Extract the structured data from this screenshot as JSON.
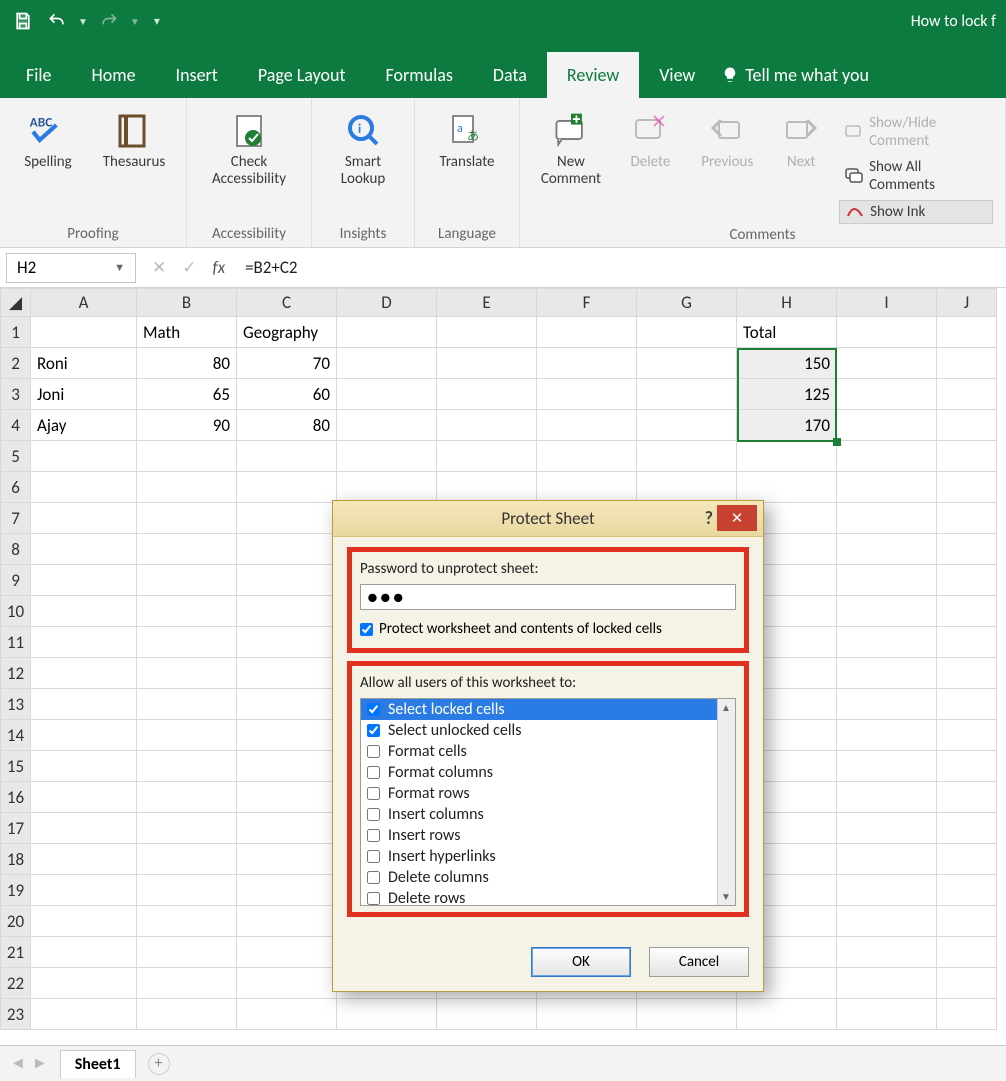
{
  "titlebar": {
    "doc_title": "How to lock f"
  },
  "tabs": {
    "file": "File",
    "home": "Home",
    "insert": "Insert",
    "pagelayout": "Page Layout",
    "formulas": "Formulas",
    "data": "Data",
    "review": "Review",
    "view": "View",
    "tellme": "Tell me what you"
  },
  "ribbon": {
    "proofing": {
      "label": "Proofing",
      "spelling": "Spelling",
      "thesaurus": "Thesaurus"
    },
    "accessibility": {
      "label": "Accessibility",
      "check": "Check\nAccessibility"
    },
    "insights": {
      "label": "Insights",
      "lookup": "Smart\nLookup"
    },
    "language": {
      "label": "Language",
      "translate": "Translate"
    },
    "comments": {
      "label": "Comments",
      "new": "New\nComment",
      "delete": "Delete",
      "previous": "Previous",
      "next": "Next",
      "showhide": "Show/Hide Comment",
      "showall": "Show All Comments",
      "showink": "Show Ink"
    }
  },
  "formula_bar": {
    "name": "H2",
    "fx": "fx",
    "formula": "=B2+C2"
  },
  "columns": [
    "A",
    "B",
    "C",
    "D",
    "E",
    "F",
    "G",
    "H",
    "I",
    "J"
  ],
  "rows": [
    "1",
    "2",
    "3",
    "4",
    "5",
    "6",
    "7",
    "8",
    "9",
    "10",
    "11",
    "12",
    "13",
    "14",
    "15",
    "16",
    "17",
    "18",
    "19",
    "20",
    "21",
    "22",
    "23"
  ],
  "cells": {
    "B1": "Math",
    "C1": "Geography",
    "H1": "Total",
    "A2": "Roni",
    "B2": "80",
    "C2": "70",
    "H2": "150",
    "A3": "Joni",
    "B3": "65",
    "C3": "60",
    "H3": "125",
    "A4": "Ajay",
    "B4": "90",
    "C4": "80",
    "H4": "170"
  },
  "dialog": {
    "title": "Protect Sheet",
    "pw_label": "Password to unprotect sheet:",
    "pw_value": "●●●",
    "protect_label": "Protect worksheet and contents of locked cells",
    "allow_label": "Allow all users of this worksheet to:",
    "options": [
      "Select locked cells",
      "Select unlocked cells",
      "Format cells",
      "Format columns",
      "Format rows",
      "Insert columns",
      "Insert rows",
      "Insert hyperlinks",
      "Delete columns",
      "Delete rows"
    ],
    "ok": "OK",
    "cancel": "Cancel"
  },
  "sheettabs": {
    "sheet1": "Sheet1"
  }
}
